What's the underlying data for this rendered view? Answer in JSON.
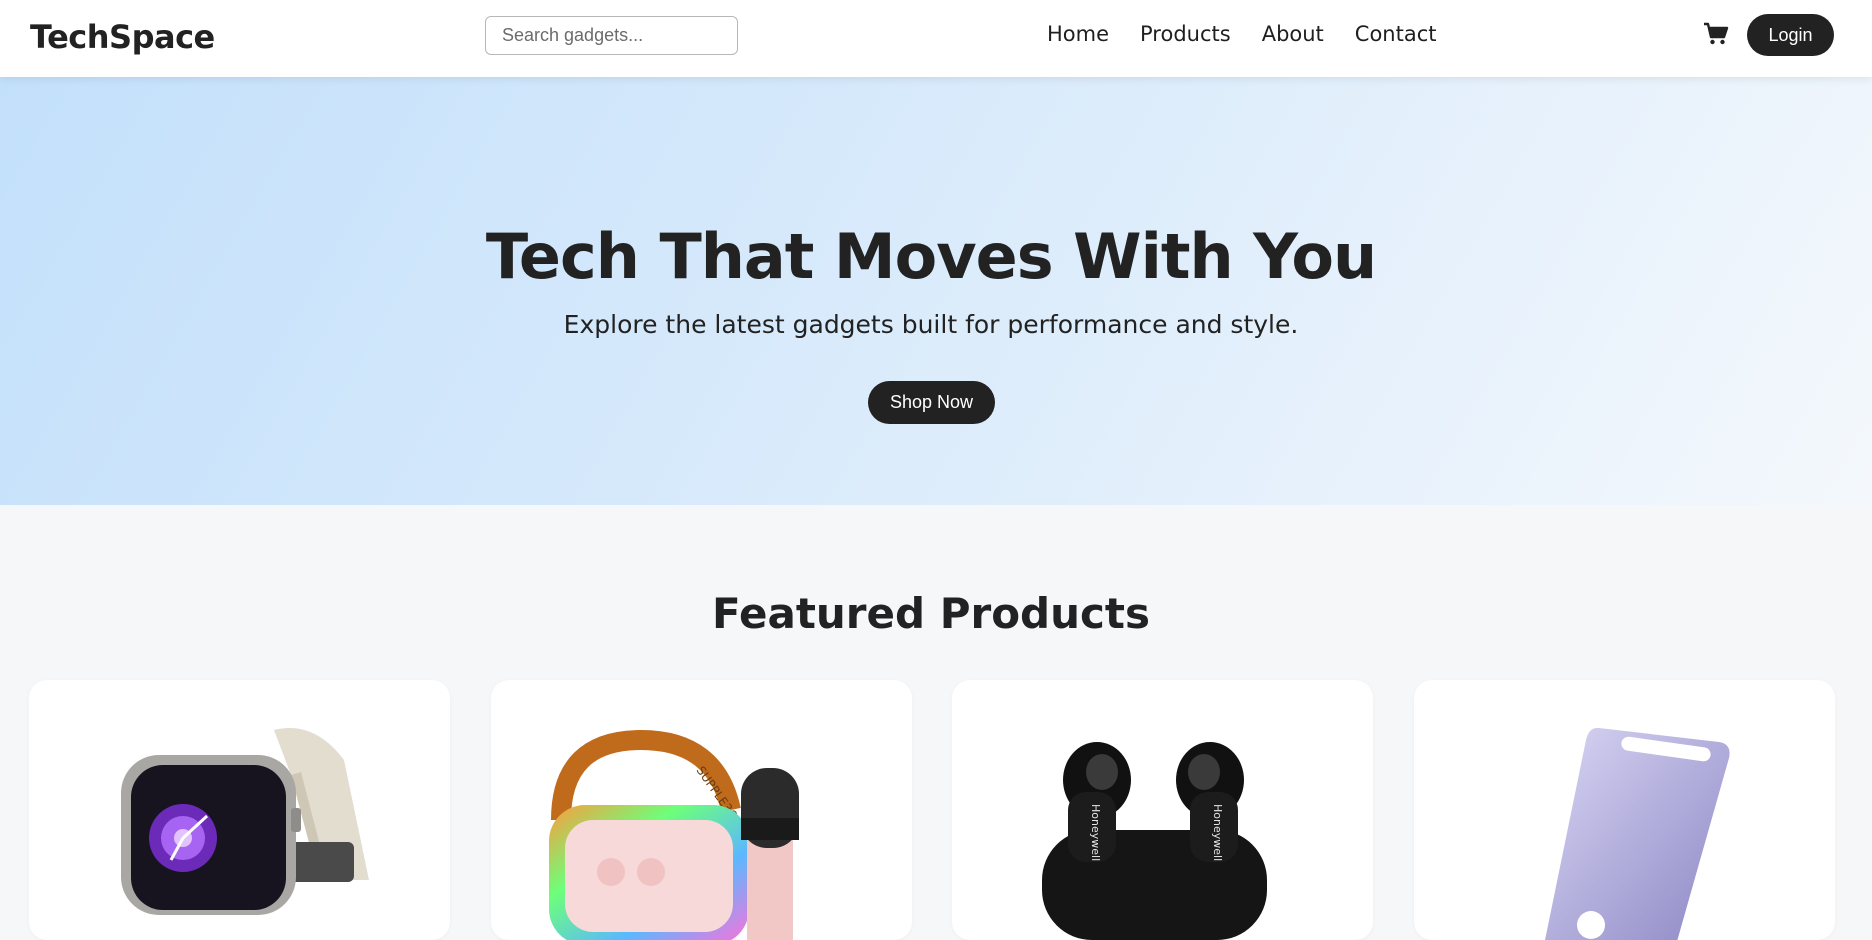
{
  "header": {
    "logo": "TechSpace",
    "search_placeholder": "Search gadgets...",
    "nav": [
      "Home",
      "Products",
      "About",
      "Contact"
    ],
    "cart_icon": "shopping-cart-icon",
    "login_label": "Login"
  },
  "hero": {
    "title": "Tech That Moves With You",
    "subtitle": "Explore the latest gadgets built for performance and style.",
    "cta_label": "Shop Now"
  },
  "featured": {
    "title": "Featured Products",
    "products": [
      {
        "image": "smartwatch"
      },
      {
        "image": "karaoke-speaker-with-microphone"
      },
      {
        "image": "wireless-earbuds",
        "brand_text": "Honeywell"
      },
      {
        "image": "phone-stand"
      }
    ]
  },
  "colors": {
    "primary_dark": "#222222",
    "hero_gradient_start": "#c3e0fb",
    "hero_gradient_end": "#f4f8fc",
    "page_background": "#f6f7f9"
  }
}
